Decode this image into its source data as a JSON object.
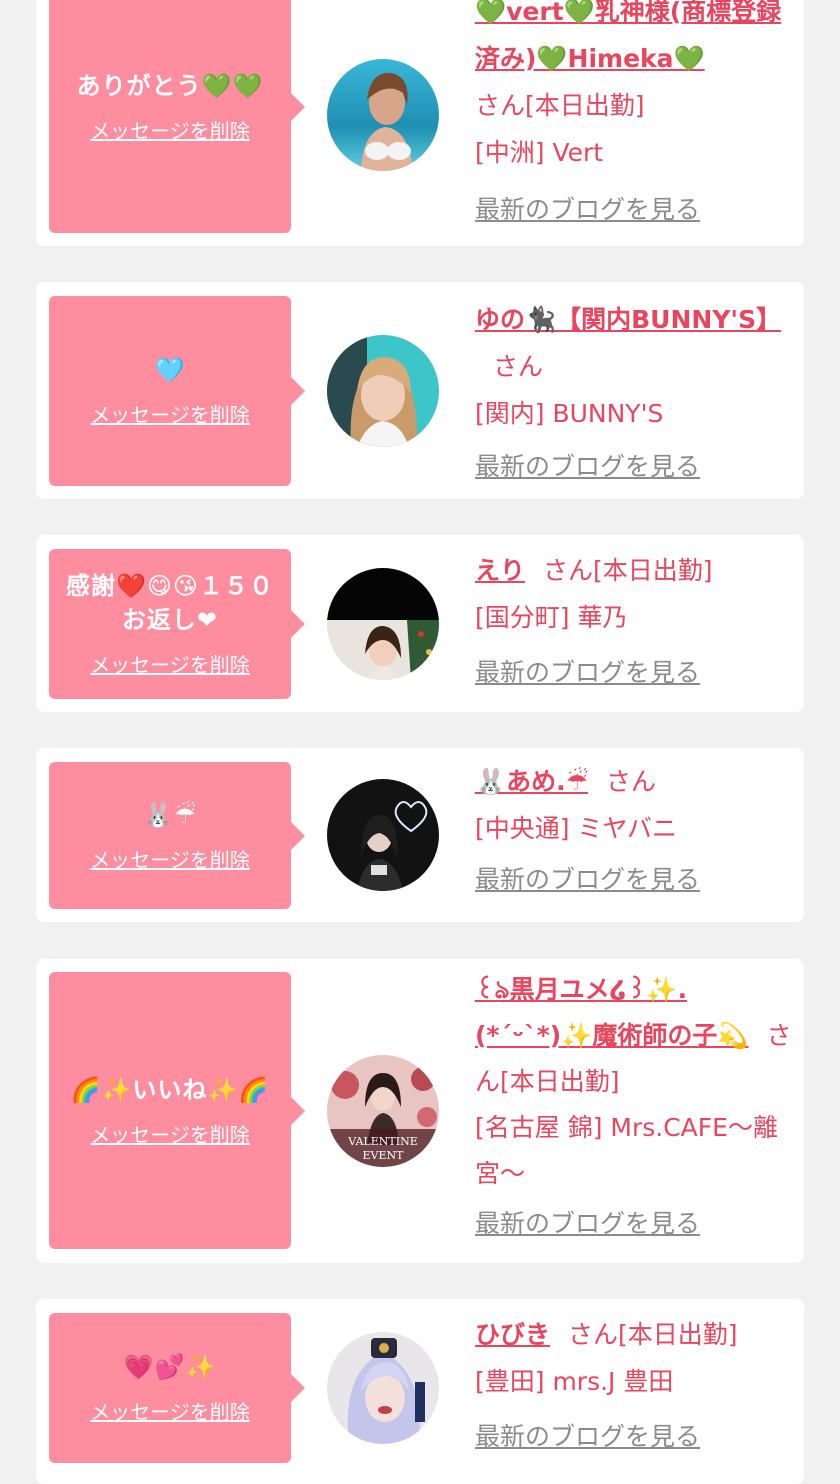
{
  "colors": {
    "background": "#f1f1f1",
    "card": "#ffffff",
    "bubble": "#fd8d9f",
    "accent": "#e8465e",
    "muted": "#8b8b8b"
  },
  "common": {
    "delete_label": "メッセージを削除",
    "blog_label": "最新のブログを見る",
    "honorific": "さん"
  },
  "items": [
    {
      "message": "ありがとう💚💚",
      "name": "💚vert💚乳神様(商標登録済み)💚Himeka💚",
      "status": "[本日出勤]",
      "shop": "[中洲] Vert",
      "avatar_icon": "avatar-beach-photo"
    },
    {
      "message": "🩵",
      "name": "ゆの🐈‍⬛【関内BUNNY'S】",
      "status": "",
      "shop": "[関内] BUNNY'S",
      "avatar_icon": "avatar-blonde-photo"
    },
    {
      "message": "感謝❤️😋😘１５０お返し❤",
      "name": "えり",
      "status": "[本日出勤]",
      "shop": "[国分町] 華乃",
      "avatar_icon": "avatar-xmas-photo"
    },
    {
      "message": "🐰☔",
      "name": "🐰あめ.☔",
      "status": "",
      "shop": "[中央通] ミヤバニ",
      "avatar_icon": "avatar-dark-heart-photo"
    },
    {
      "message": "🌈✨いいね✨🌈",
      "name": "꒰ঌ黒月ユメ໒꒱✨.(*ˊᵕˋ*)✨魔術師の子💫",
      "status": "[本日出勤]",
      "shop": "[名古屋 錦] Mrs.CAFE〜離宮〜",
      "avatar_icon": "avatar-valentine-photo"
    },
    {
      "message": "💗💕✨",
      "name": "ひびき",
      "status": "[本日出勤]",
      "shop": "[豊田] mrs.J 豊田",
      "avatar_icon": "avatar-silver-hair-photo"
    }
  ]
}
